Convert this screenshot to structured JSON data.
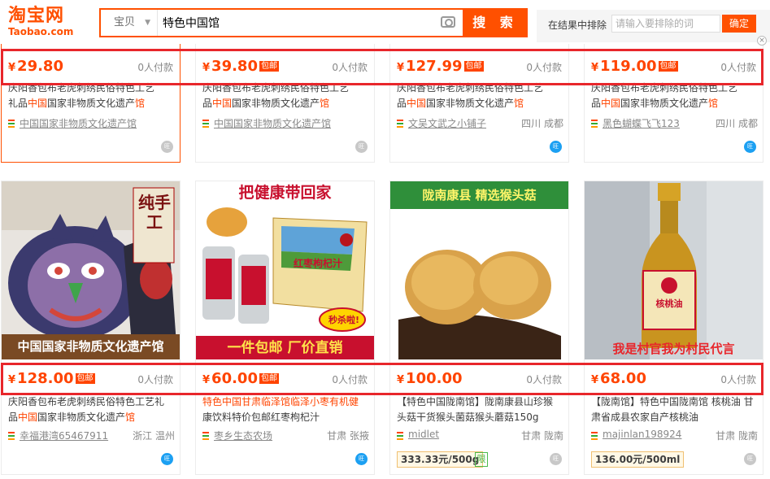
{
  "header": {
    "logo_cn": "淘宝网",
    "logo_en": "Taobao.com",
    "search_category": "宝贝",
    "search_query": "特色中国馆",
    "search_button": "搜 索",
    "exclude_label": "在结果中排除",
    "exclude_placeholder": "请输入要排除的词",
    "exclude_button": "确定"
  },
  "colors": {
    "brand": "#ff5000",
    "price": "#ff4400",
    "highlight": "#e8262b"
  },
  "row1": [
    {
      "price": "29.80",
      "baoyou": "",
      "paid": "0人付款",
      "title_a": "庆阳香包布老虎刺绣民俗特色工艺",
      "title_b": "礼品",
      "title_hl": "中国",
      "title_c": "国家非物质文化遗产",
      "title_hl2": "馆",
      "shop": "中国国家非物质文化遗产馆",
      "location": "",
      "ww": "off"
    },
    {
      "price": "39.80",
      "baoyou": "包邮",
      "paid": "0人付款",
      "title_a": "庆阳香包布老虎刺绣民俗特色工艺",
      "title_b": "品",
      "title_hl": "中国",
      "title_c": "国家非物质文化遗产",
      "title_hl2": "馆",
      "shop": "中国国家非物质文化遗产馆",
      "location": "",
      "ww": "off"
    },
    {
      "price": "127.99",
      "baoyou": "包邮",
      "paid": "0人付款",
      "title_a": "庆阳香包布老虎刺绣民俗特色工艺",
      "title_b": "品",
      "title_hl": "中国",
      "title_c": "国家非物质文化遗产",
      "title_hl2": "馆",
      "shop": "文吴文武之小铺子",
      "location": "四川 成都",
      "ww": "on"
    },
    {
      "price": "119.00",
      "baoyou": "包邮",
      "paid": "0人付款",
      "title_a": "庆阳香包布老虎刺绣民俗特色工艺",
      "title_b": "品",
      "title_hl": "中国",
      "title_c": "国家非物质文化遗产",
      "title_hl2": "馆",
      "shop": "黑色蝴蝶飞飞123",
      "location": "四川 成都",
      "ww": "on"
    }
  ],
  "row2": [
    {
      "img_banner": "中国国家非物质文化遗产馆",
      "img_side": "纯手工",
      "price": "128.00",
      "baoyou": "包邮",
      "paid": "0人付款",
      "title_line1": "庆阳香包布老虎刺绣民俗特色工艺礼",
      "title_line2_pre": "品",
      "title_line2_hl": "中国",
      "title_line2_post": "国家非物质文化遗产",
      "title_line2_hl2": "馆",
      "shop": "幸福港湾65467911",
      "location": "浙江 温州",
      "ww": "on"
    },
    {
      "img_top": "把健康带回家",
      "img_bottom": "一件包邮 厂价直销",
      "img_label": "红枣枸杞汁",
      "img_sticker": "秒杀啦!",
      "price": "60.00",
      "baoyou": "包邮",
      "paid": "0人付款",
      "title_line1": "特色中国甘肃临泽馆临泽小枣有机健",
      "title_line2_pre": "康饮料特价包邮红枣枸杞汁",
      "title_line2_hl": "",
      "title_line2_post": "",
      "title_line2_hl2": "",
      "shop": "枣乡生态农场",
      "location": "甘肃 张掖",
      "ww": "on"
    },
    {
      "img_top": "陇南康县 精选猴头菇",
      "price": "100.00",
      "baoyou": "",
      "paid": "0人付款",
      "title_line1": "【特色中国陇南馆】陇南康县山珍猴",
      "title_line2_pre": "头菇干货猴头菌菇猴头蘑菇150g",
      "title_line2_hl": "",
      "title_line2_post": "",
      "title_line2_hl2": "",
      "shop": "midlet",
      "location": "甘肃 陇南",
      "ww": "off",
      "unit": "333.33元/500g",
      "green_tag": "限"
    },
    {
      "img_bottom": "我是村官我为村民代言",
      "img_label": "核桃油",
      "price": "68.00",
      "baoyou": "",
      "paid": "0人付款",
      "title_line1": "【陇南馆】特色中国陇南馆 核桃油 甘",
      "title_line2_pre": "肃省成县农家自产核桃油",
      "title_line2_hl": "",
      "title_line2_post": "",
      "title_line2_hl2": "",
      "shop": "majinlan198924",
      "location": "甘肃 陇南",
      "ww": "off",
      "unit": "136.00元/500ml"
    }
  ],
  "currency": "¥",
  "close_glyph": "×",
  "ww_glyph": "旺"
}
